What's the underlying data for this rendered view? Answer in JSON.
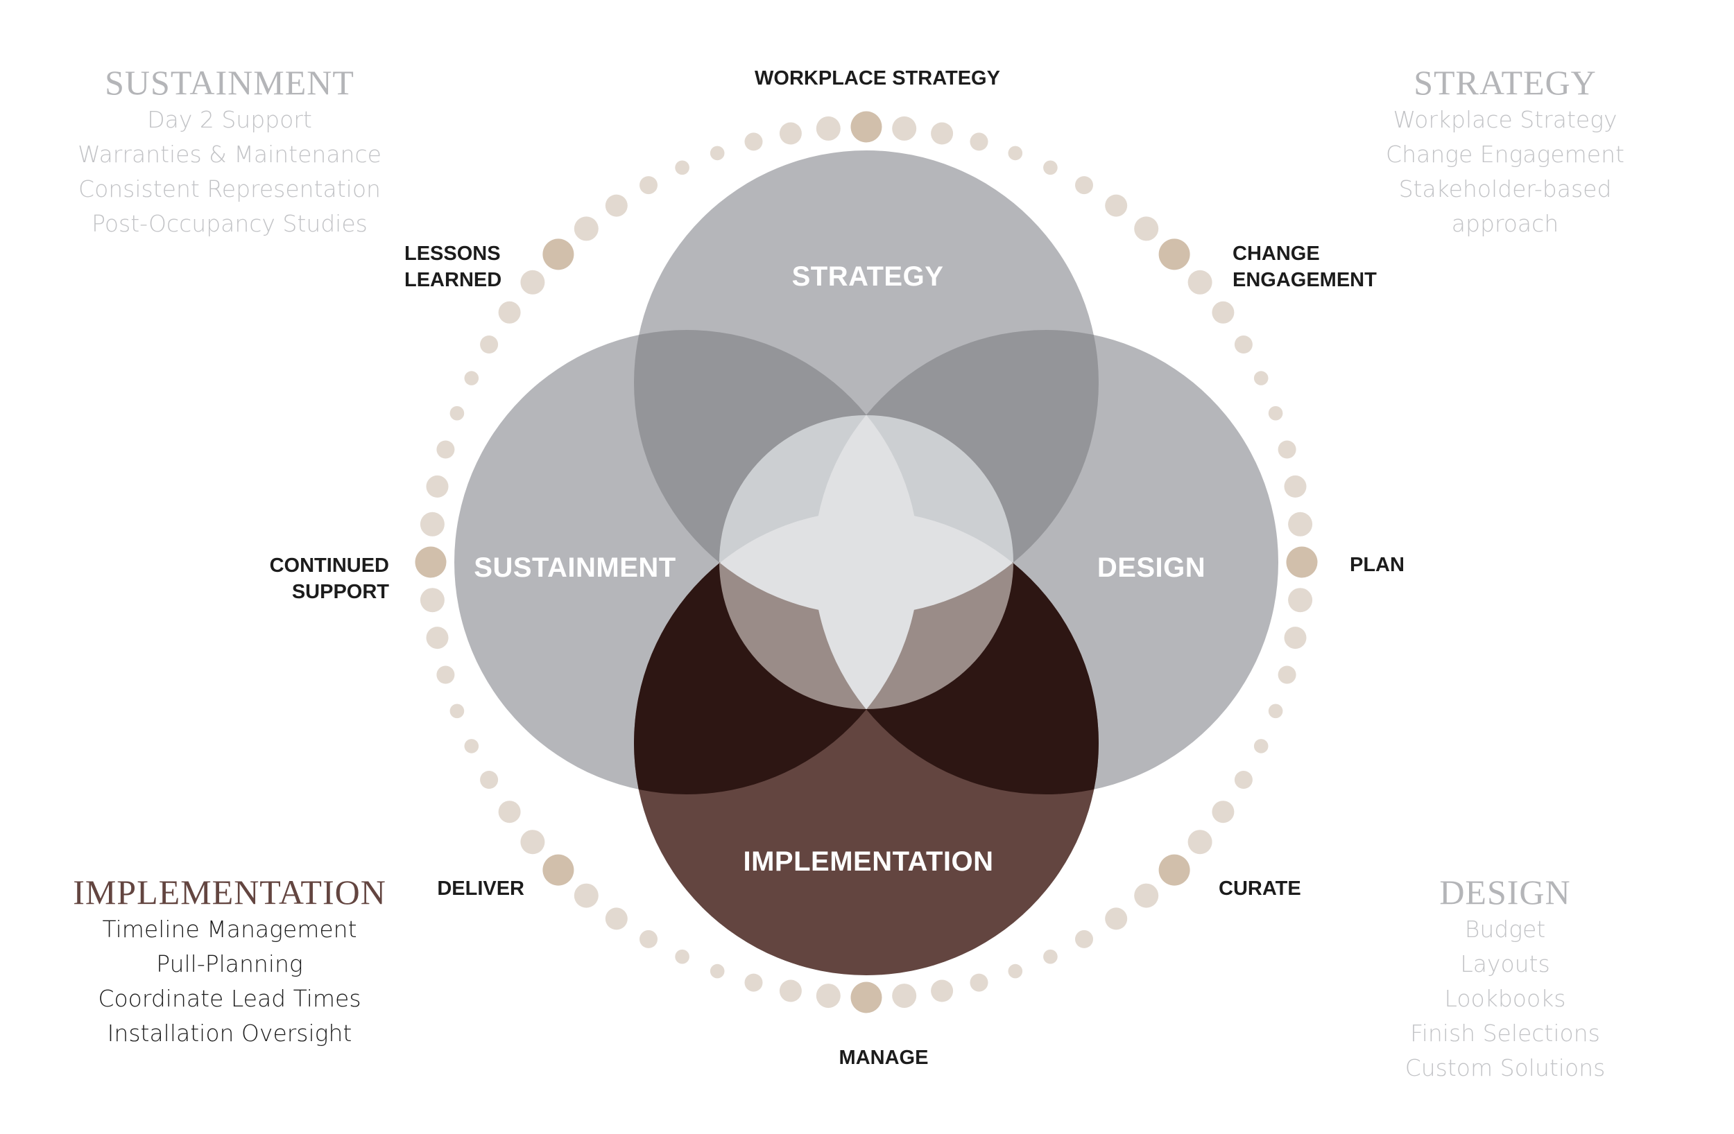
{
  "colors": {
    "circle_gray": "#b5b6ba",
    "overlap_gray": "#949599",
    "implementation": "#634540",
    "overlap_dark": "#2d1613",
    "inner_top": "#cccfd2",
    "inner_bottom": "#9a8c88",
    "center_star": "#e0e1e3",
    "dot": "#e2d9d0",
    "dot_accent": "#d1bfab",
    "muted_text": "#b4b5b8",
    "muted_item": "#c2c3c6",
    "dark_text": "#1c1c1c",
    "accent_text": "#634540"
  },
  "circles": {
    "strategy": "STRATEGY",
    "sustainment": "SUSTAINMENT",
    "design": "DESIGN",
    "implementation": "IMPLEMENTATION"
  },
  "ring": {
    "dot_count": 72,
    "accent_every": 9,
    "labels": {
      "top": [
        "WORKPLACE STRATEGY"
      ],
      "top_right": [
        "CHANGE",
        "ENGAGEMENT"
      ],
      "right": [
        "PLAN"
      ],
      "bottom_right": [
        "CURATE"
      ],
      "bottom": [
        "MANAGE"
      ],
      "bottom_left": [
        "DELIVER"
      ],
      "left": [
        "CONTINUED",
        "SUPPORT"
      ],
      "top_left": [
        "LESSONS",
        "LEARNED"
      ]
    }
  },
  "blocks": {
    "sustainment": {
      "title": "SUSTAINMENT",
      "items": [
        "Day 2 Support",
        "Warranties & Maintenance",
        "Consistent Representation",
        "Post-Occupancy Studies"
      ],
      "highlighted": false
    },
    "strategy": {
      "title": "STRATEGY",
      "items": [
        "Workplace Strategy",
        "Change Engagement",
        "Stakeholder-based",
        "approach"
      ],
      "highlighted": false
    },
    "implementation": {
      "title": "IMPLEMENTATION",
      "items": [
        "Timeline Management",
        "Pull-Planning",
        "Coordinate Lead Times",
        "Installation Oversight"
      ],
      "highlighted": true
    },
    "design": {
      "title": "DESIGN",
      "items": [
        "Budget",
        "Layouts",
        "Lookbooks",
        "Finish Selections",
        "Custom Solutions"
      ],
      "highlighted": false
    }
  }
}
